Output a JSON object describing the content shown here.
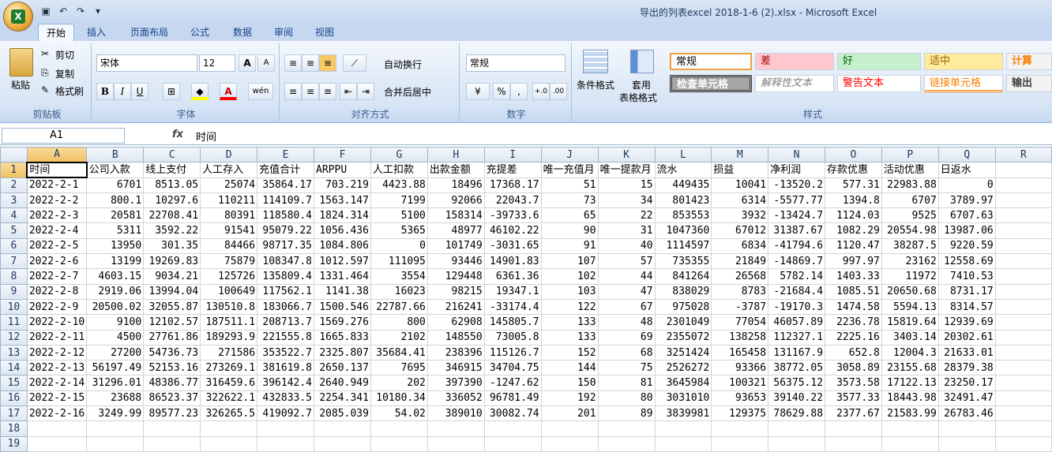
{
  "window": {
    "title": "导出的列表excel 2018-1-6 (2).xlsx - Microsoft Excel"
  },
  "qat": [
    "save-icon",
    "undo-icon",
    "redo-icon",
    "customize-icon"
  ],
  "tabs": [
    "开始",
    "插入",
    "页面布局",
    "公式",
    "数据",
    "审阅",
    "视图"
  ],
  "ribbon": {
    "clipboard": {
      "paste": "粘贴",
      "cut": "剪切",
      "copy": "复制",
      "format_painter": "格式刷",
      "label": "剪贴板"
    },
    "font": {
      "name": "宋体",
      "size": "12",
      "grow": "A",
      "shrink": "A",
      "bold": "B",
      "italic": "I",
      "underline": "U",
      "phonetic": "wén",
      "label": "字体"
    },
    "alignment": {
      "wrap": "自动换行",
      "merge": "合并后居中",
      "label": "对齐方式"
    },
    "number": {
      "format": "常规",
      "percent": "%",
      "comma": ",",
      "inc": "+.0",
      "dec": ".00",
      "label": "数字"
    },
    "styles": {
      "conditional": "条件格式",
      "table_format_1": "套用",
      "table_format_2": "表格格式",
      "label": "样式",
      "cells": [
        "常规",
        "差",
        "好",
        "适中",
        "计算",
        "检查单元格",
        "解释性文本",
        "警告文本",
        "链接单元格",
        "输出"
      ]
    }
  },
  "formula_bar": {
    "name_box": "A1",
    "fx": "fx",
    "value": "时间"
  },
  "columns": [
    "A",
    "B",
    "C",
    "D",
    "E",
    "F",
    "G",
    "H",
    "I",
    "J",
    "K",
    "L",
    "M",
    "N",
    "O",
    "P",
    "Q",
    "R"
  ],
  "headers": [
    "时间",
    "公司入款",
    "线上支付",
    "人工存入",
    "充值合计",
    "ARPPU",
    "人工扣款",
    "出款金额",
    "充提差",
    "唯一充值月",
    "唯一提款月",
    "流水",
    "损益",
    "净利润",
    "存款优惠",
    "活动优惠",
    "日返水"
  ],
  "rows": [
    [
      "2022-2-1",
      "6701",
      "8513.05",
      "25074",
      "35864.17",
      "703.219",
      "4423.88",
      "18496",
      "17368.17",
      "51",
      "15",
      "449435",
      "10041",
      "-13520.2",
      "577.31",
      "22983.88",
      "0"
    ],
    [
      "2022-2-2",
      "800.1",
      "10297.6",
      "110211",
      "114109.7",
      "1563.147",
      "7199",
      "92066",
      "22043.7",
      "73",
      "34",
      "801423",
      "6314",
      "-5577.77",
      "1394.8",
      "6707",
      "3789.97"
    ],
    [
      "2022-2-3",
      "20581",
      "22708.41",
      "80391",
      "118580.4",
      "1824.314",
      "5100",
      "158314",
      "-39733.6",
      "65",
      "22",
      "853553",
      "3932",
      "-13424.7",
      "1124.03",
      "9525",
      "6707.63"
    ],
    [
      "2022-2-4",
      "5311",
      "3592.22",
      "91541",
      "95079.22",
      "1056.436",
      "5365",
      "48977",
      "46102.22",
      "90",
      "31",
      "1047360",
      "67012",
      "31387.67",
      "1082.29",
      "20554.98",
      "13987.06"
    ],
    [
      "2022-2-5",
      "13950",
      "301.35",
      "84466",
      "98717.35",
      "1084.806",
      "0",
      "101749",
      "-3031.65",
      "91",
      "40",
      "1114597",
      "6834",
      "-41794.6",
      "1120.47",
      "38287.5",
      "9220.59"
    ],
    [
      "2022-2-6",
      "13199",
      "19269.83",
      "75879",
      "108347.8",
      "1012.597",
      "111095",
      "93446",
      "14901.83",
      "107",
      "57",
      "735355",
      "21849",
      "-14869.7",
      "997.97",
      "23162",
      "12558.69"
    ],
    [
      "2022-2-7",
      "4603.15",
      "9034.21",
      "125726",
      "135809.4",
      "1331.464",
      "3554",
      "129448",
      "6361.36",
      "102",
      "44",
      "841264",
      "26568",
      "5782.14",
      "1403.33",
      "11972",
      "7410.53"
    ],
    [
      "2022-2-8",
      "2919.06",
      "13994.04",
      "100649",
      "117562.1",
      "1141.38",
      "16023",
      "98215",
      "19347.1",
      "103",
      "47",
      "838029",
      "8783",
      "-21684.4",
      "1085.51",
      "20650.68",
      "8731.17"
    ],
    [
      "2022-2-9",
      "20500.02",
      "32055.87",
      "130510.8",
      "183066.7",
      "1500.546",
      "22787.66",
      "216241",
      "-33174.4",
      "122",
      "67",
      "975028",
      "-3787",
      "-19170.3",
      "1474.58",
      "5594.13",
      "8314.57"
    ],
    [
      "2022-2-10",
      "9100",
      "12102.57",
      "187511.1",
      "208713.7",
      "1569.276",
      "800",
      "62908",
      "145805.7",
      "133",
      "48",
      "2301049",
      "77054",
      "46057.89",
      "2236.78",
      "15819.64",
      "12939.69"
    ],
    [
      "2022-2-11",
      "4500",
      "27761.86",
      "189293.9",
      "221555.8",
      "1665.833",
      "2102",
      "148550",
      "73005.8",
      "133",
      "69",
      "2355072",
      "138258",
      "112327.1",
      "2225.16",
      "3403.14",
      "20302.61"
    ],
    [
      "2022-2-12",
      "27200",
      "54736.73",
      "271586",
      "353522.7",
      "2325.807",
      "35684.41",
      "238396",
      "115126.7",
      "152",
      "68",
      "3251424",
      "165458",
      "131167.9",
      "652.8",
      "12004.3",
      "21633.01"
    ],
    [
      "2022-2-13",
      "56197.49",
      "52153.16",
      "273269.1",
      "381619.8",
      "2650.137",
      "7695",
      "346915",
      "34704.75",
      "144",
      "75",
      "2526272",
      "93366",
      "38772.05",
      "3058.89",
      "23155.68",
      "28379.38"
    ],
    [
      "2022-2-14",
      "31296.01",
      "48386.77",
      "316459.6",
      "396142.4",
      "2640.949",
      "202",
      "397390",
      "-1247.62",
      "150",
      "81",
      "3645984",
      "100321",
      "56375.12",
      "3573.58",
      "17122.13",
      "23250.17"
    ],
    [
      "2022-2-15",
      "23688",
      "86523.37",
      "322622.1",
      "432833.5",
      "2254.341",
      "10180.34",
      "336052",
      "96781.49",
      "192",
      "80",
      "3031010",
      "93653",
      "39140.22",
      "3577.33",
      "18443.98",
      "32491.47"
    ],
    [
      "2022-2-16",
      "3249.99",
      "89577.23",
      "326265.5",
      "419092.7",
      "2085.039",
      "54.02",
      "389010",
      "30082.74",
      "201",
      "89",
      "3839981",
      "129375",
      "78629.88",
      "2377.67",
      "21583.99",
      "26783.46"
    ]
  ],
  "row_numbers": [
    "1",
    "2",
    "3",
    "4",
    "5",
    "6",
    "7",
    "8",
    "9",
    "10",
    "11",
    "12",
    "13",
    "14",
    "15",
    "16",
    "17",
    "18",
    "19"
  ]
}
